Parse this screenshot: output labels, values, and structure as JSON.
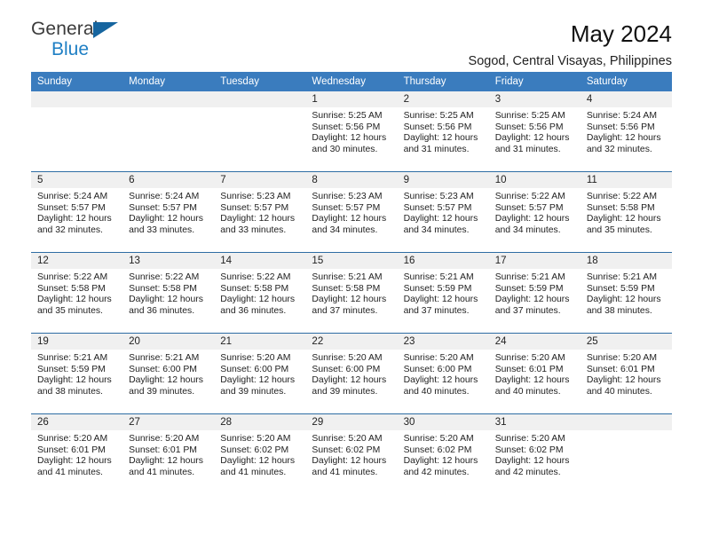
{
  "logo": {
    "word_top": "General",
    "word_bottom": "Blue",
    "accent_color": "#16659f"
  },
  "header": {
    "title": "May 2024",
    "subtitle": "Sogod, Central Visayas, Philippines"
  },
  "theme": {
    "header_blue": "#3a7cbe",
    "rule_blue": "#2e6da4",
    "daynum_bg": "#f0f0f0"
  },
  "weekday_headers": [
    "Sunday",
    "Monday",
    "Tuesday",
    "Wednesday",
    "Thursday",
    "Friday",
    "Saturday"
  ],
  "weeks": [
    [
      {
        "day": "",
        "empty": true
      },
      {
        "day": "",
        "empty": true
      },
      {
        "day": "",
        "empty": true
      },
      {
        "day": "1",
        "sunrise": "Sunrise: 5:25 AM",
        "sunset": "Sunset: 5:56 PM",
        "daylight_line1": "Daylight: 12 hours",
        "daylight_line2": "and 30 minutes."
      },
      {
        "day": "2",
        "sunrise": "Sunrise: 5:25 AM",
        "sunset": "Sunset: 5:56 PM",
        "daylight_line1": "Daylight: 12 hours",
        "daylight_line2": "and 31 minutes."
      },
      {
        "day": "3",
        "sunrise": "Sunrise: 5:25 AM",
        "sunset": "Sunset: 5:56 PM",
        "daylight_line1": "Daylight: 12 hours",
        "daylight_line2": "and 31 minutes."
      },
      {
        "day": "4",
        "sunrise": "Sunrise: 5:24 AM",
        "sunset": "Sunset: 5:56 PM",
        "daylight_line1": "Daylight: 12 hours",
        "daylight_line2": "and 32 minutes."
      }
    ],
    [
      {
        "day": "5",
        "sunrise": "Sunrise: 5:24 AM",
        "sunset": "Sunset: 5:57 PM",
        "daylight_line1": "Daylight: 12 hours",
        "daylight_line2": "and 32 minutes."
      },
      {
        "day": "6",
        "sunrise": "Sunrise: 5:24 AM",
        "sunset": "Sunset: 5:57 PM",
        "daylight_line1": "Daylight: 12 hours",
        "daylight_line2": "and 33 minutes."
      },
      {
        "day": "7",
        "sunrise": "Sunrise: 5:23 AM",
        "sunset": "Sunset: 5:57 PM",
        "daylight_line1": "Daylight: 12 hours",
        "daylight_line2": "and 33 minutes."
      },
      {
        "day": "8",
        "sunrise": "Sunrise: 5:23 AM",
        "sunset": "Sunset: 5:57 PM",
        "daylight_line1": "Daylight: 12 hours",
        "daylight_line2": "and 34 minutes."
      },
      {
        "day": "9",
        "sunrise": "Sunrise: 5:23 AM",
        "sunset": "Sunset: 5:57 PM",
        "daylight_line1": "Daylight: 12 hours",
        "daylight_line2": "and 34 minutes."
      },
      {
        "day": "10",
        "sunrise": "Sunrise: 5:22 AM",
        "sunset": "Sunset: 5:57 PM",
        "daylight_line1": "Daylight: 12 hours",
        "daylight_line2": "and 34 minutes."
      },
      {
        "day": "11",
        "sunrise": "Sunrise: 5:22 AM",
        "sunset": "Sunset: 5:58 PM",
        "daylight_line1": "Daylight: 12 hours",
        "daylight_line2": "and 35 minutes."
      }
    ],
    [
      {
        "day": "12",
        "sunrise": "Sunrise: 5:22 AM",
        "sunset": "Sunset: 5:58 PM",
        "daylight_line1": "Daylight: 12 hours",
        "daylight_line2": "and 35 minutes."
      },
      {
        "day": "13",
        "sunrise": "Sunrise: 5:22 AM",
        "sunset": "Sunset: 5:58 PM",
        "daylight_line1": "Daylight: 12 hours",
        "daylight_line2": "and 36 minutes."
      },
      {
        "day": "14",
        "sunrise": "Sunrise: 5:22 AM",
        "sunset": "Sunset: 5:58 PM",
        "daylight_line1": "Daylight: 12 hours",
        "daylight_line2": "and 36 minutes."
      },
      {
        "day": "15",
        "sunrise": "Sunrise: 5:21 AM",
        "sunset": "Sunset: 5:58 PM",
        "daylight_line1": "Daylight: 12 hours",
        "daylight_line2": "and 37 minutes."
      },
      {
        "day": "16",
        "sunrise": "Sunrise: 5:21 AM",
        "sunset": "Sunset: 5:59 PM",
        "daylight_line1": "Daylight: 12 hours",
        "daylight_line2": "and 37 minutes."
      },
      {
        "day": "17",
        "sunrise": "Sunrise: 5:21 AM",
        "sunset": "Sunset: 5:59 PM",
        "daylight_line1": "Daylight: 12 hours",
        "daylight_line2": "and 37 minutes."
      },
      {
        "day": "18",
        "sunrise": "Sunrise: 5:21 AM",
        "sunset": "Sunset: 5:59 PM",
        "daylight_line1": "Daylight: 12 hours",
        "daylight_line2": "and 38 minutes."
      }
    ],
    [
      {
        "day": "19",
        "sunrise": "Sunrise: 5:21 AM",
        "sunset": "Sunset: 5:59 PM",
        "daylight_line1": "Daylight: 12 hours",
        "daylight_line2": "and 38 minutes."
      },
      {
        "day": "20",
        "sunrise": "Sunrise: 5:21 AM",
        "sunset": "Sunset: 6:00 PM",
        "daylight_line1": "Daylight: 12 hours",
        "daylight_line2": "and 39 minutes."
      },
      {
        "day": "21",
        "sunrise": "Sunrise: 5:20 AM",
        "sunset": "Sunset: 6:00 PM",
        "daylight_line1": "Daylight: 12 hours",
        "daylight_line2": "and 39 minutes."
      },
      {
        "day": "22",
        "sunrise": "Sunrise: 5:20 AM",
        "sunset": "Sunset: 6:00 PM",
        "daylight_line1": "Daylight: 12 hours",
        "daylight_line2": "and 39 minutes."
      },
      {
        "day": "23",
        "sunrise": "Sunrise: 5:20 AM",
        "sunset": "Sunset: 6:00 PM",
        "daylight_line1": "Daylight: 12 hours",
        "daylight_line2": "and 40 minutes."
      },
      {
        "day": "24",
        "sunrise": "Sunrise: 5:20 AM",
        "sunset": "Sunset: 6:01 PM",
        "daylight_line1": "Daylight: 12 hours",
        "daylight_line2": "and 40 minutes."
      },
      {
        "day": "25",
        "sunrise": "Sunrise: 5:20 AM",
        "sunset": "Sunset: 6:01 PM",
        "daylight_line1": "Daylight: 12 hours",
        "daylight_line2": "and 40 minutes."
      }
    ],
    [
      {
        "day": "26",
        "sunrise": "Sunrise: 5:20 AM",
        "sunset": "Sunset: 6:01 PM",
        "daylight_line1": "Daylight: 12 hours",
        "daylight_line2": "and 41 minutes."
      },
      {
        "day": "27",
        "sunrise": "Sunrise: 5:20 AM",
        "sunset": "Sunset: 6:01 PM",
        "daylight_line1": "Daylight: 12 hours",
        "daylight_line2": "and 41 minutes."
      },
      {
        "day": "28",
        "sunrise": "Sunrise: 5:20 AM",
        "sunset": "Sunset: 6:02 PM",
        "daylight_line1": "Daylight: 12 hours",
        "daylight_line2": "and 41 minutes."
      },
      {
        "day": "29",
        "sunrise": "Sunrise: 5:20 AM",
        "sunset": "Sunset: 6:02 PM",
        "daylight_line1": "Daylight: 12 hours",
        "daylight_line2": "and 41 minutes."
      },
      {
        "day": "30",
        "sunrise": "Sunrise: 5:20 AM",
        "sunset": "Sunset: 6:02 PM",
        "daylight_line1": "Daylight: 12 hours",
        "daylight_line2": "and 42 minutes."
      },
      {
        "day": "31",
        "sunrise": "Sunrise: 5:20 AM",
        "sunset": "Sunset: 6:02 PM",
        "daylight_line1": "Daylight: 12 hours",
        "daylight_line2": "and 42 minutes."
      },
      {
        "day": "",
        "empty": true
      }
    ]
  ]
}
